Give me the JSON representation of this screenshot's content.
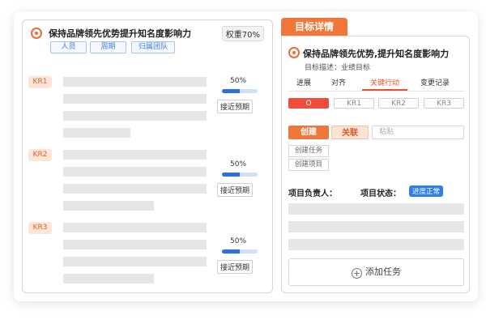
{
  "objective": {
    "title": "保持品牌领先优势提升知名度影响力",
    "weight": "权重70%",
    "chips": [
      "人员",
      "周期",
      "归属团队"
    ]
  },
  "key_results": [
    {
      "tag": "KR1",
      "percent_label": "50%",
      "progress": 0.5,
      "status": "接近预期"
    },
    {
      "tag": "KR2",
      "percent_label": "50%",
      "progress": 0.5,
      "status": "接近预期"
    },
    {
      "tag": "KR3",
      "percent_label": "50%",
      "progress": 0.5,
      "status": "接近预期"
    }
  ],
  "detail": {
    "header_tab": "目标详情",
    "title": "保持品牌领先优势,提升知名度影响力",
    "description": "目标描述：业绩目标",
    "tabs": [
      "进展",
      "对齐",
      "关键行动",
      "变更记录"
    ],
    "active_tab": "关键行动",
    "segments": [
      "O",
      "KR1",
      "KR2",
      "KR3"
    ],
    "create_label": "创建",
    "link_label": "关联",
    "paste_placeholder": "粘贴",
    "create_menu": [
      "创建任务",
      "创建项目"
    ],
    "owner_label": "项目负责人：",
    "status_label": "项目状态：",
    "status_value": "进度正常",
    "add_task_label": "添加任务"
  },
  "colors": {
    "accent_orange": "#f0773a",
    "active_red": "#ef4c3c",
    "progress_blue": "#2f6fe0",
    "status_blue": "#2f7de9"
  }
}
